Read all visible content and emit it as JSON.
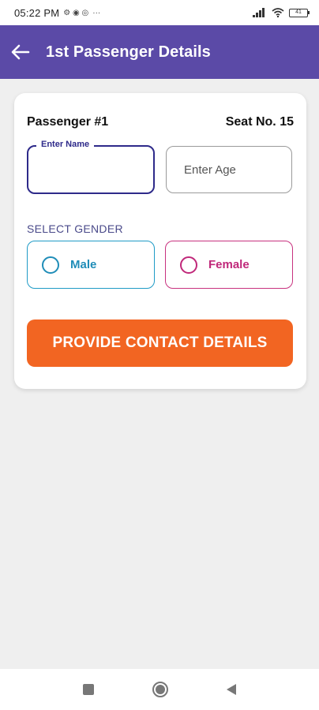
{
  "status_bar": {
    "time": "05:22 PM",
    "notif_icons": "⚙ ◉ ◎",
    "more": "···",
    "battery": "41"
  },
  "app_bar": {
    "title": "1st Passenger Details",
    "color": "#5b4aa7"
  },
  "card": {
    "passenger_label": "Passenger #1",
    "seat_label": "Seat No. 15",
    "name_field": {
      "label": "Enter Name",
      "value": ""
    },
    "age_field": {
      "placeholder": "Enter Age",
      "value": ""
    },
    "gender_label": "SELECT GENDER",
    "gender_options": [
      {
        "label": "Male",
        "color": "#1f8db8"
      },
      {
        "label": "Female",
        "color": "#c0287a"
      }
    ],
    "primary_button": {
      "label": "PROVIDE CONTACT DETAILS",
      "color": "#f26522"
    }
  }
}
